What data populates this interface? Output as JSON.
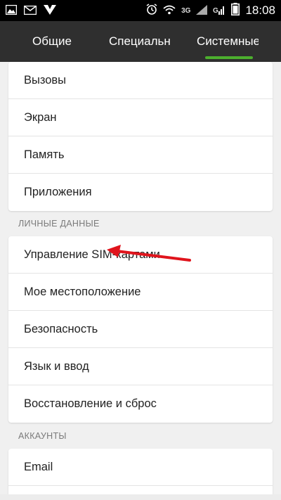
{
  "status_bar": {
    "time": "18:08",
    "network": "3G",
    "left_icons": [
      "image-icon",
      "mail-icon",
      "app-notification-icon"
    ],
    "right_icons": [
      "alarm-icon",
      "wifi-icon",
      "signal-icon",
      "signal-2-icon",
      "battery-icon"
    ]
  },
  "tabs": [
    {
      "label": "Общие"
    },
    {
      "label": "Специальные"
    },
    {
      "label": "Системные"
    }
  ],
  "active_tab": 2,
  "sections": {
    "system": {
      "items": [
        "Вызовы",
        "Экран",
        "Память",
        "Приложения"
      ]
    },
    "personal": {
      "title": "ЛИЧНЫЕ ДАННЫЕ",
      "items": [
        "Управление SIM-картами",
        "Мое местоположение",
        "Безопасность",
        "Язык и ввод",
        "Восстановление и сброс"
      ]
    },
    "accounts": {
      "title": "АККАУНТЫ",
      "items": [
        "Email"
      ]
    }
  },
  "colors": {
    "tab_indicator": "#4caf2e",
    "annotation_arrow": "#e0141c",
    "tab_bar_bg": "#2f2f2f",
    "page_bg": "#f0f0f0"
  }
}
